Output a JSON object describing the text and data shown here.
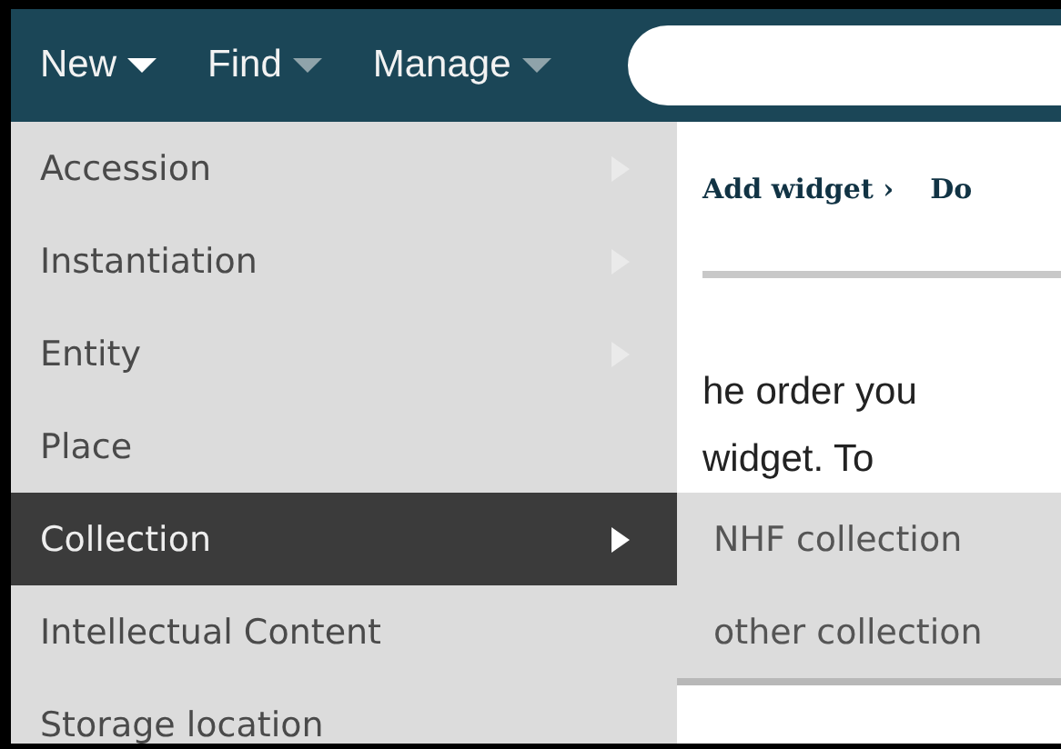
{
  "nav": [
    {
      "label": "New",
      "active": true
    },
    {
      "label": "Find",
      "active": false
    },
    {
      "label": "Manage",
      "active": false
    }
  ],
  "toolbar": {
    "links": [
      "Add widget ›",
      "Do"
    ]
  },
  "body_text": [
    "he order you",
    "widget. To"
  ],
  "menu": [
    {
      "label": "Accession",
      "selected": false,
      "has_submenu": true
    },
    {
      "label": "Instantiation",
      "selected": false,
      "has_submenu": true
    },
    {
      "label": "Entity",
      "selected": false,
      "has_submenu": true
    },
    {
      "label": "Place",
      "selected": false,
      "has_submenu": false
    },
    {
      "label": "Collection",
      "selected": true,
      "has_submenu": true
    },
    {
      "label": "Intellectual Content",
      "selected": false,
      "has_submenu": false
    },
    {
      "label": "Storage location",
      "selected": false,
      "has_submenu": false
    }
  ],
  "submenu": [
    {
      "label": "NHF collection"
    },
    {
      "label": "other collection"
    }
  ]
}
